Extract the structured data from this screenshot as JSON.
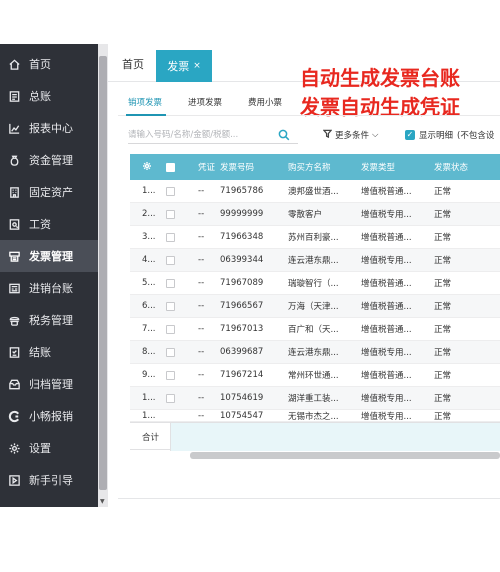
{
  "sidebar": {
    "items": [
      {
        "label": "首页",
        "icon": "home-icon"
      },
      {
        "label": "总账",
        "icon": "ledger-icon"
      },
      {
        "label": "报表中心",
        "icon": "chart-icon"
      },
      {
        "label": "资金管理",
        "icon": "money-bag-icon"
      },
      {
        "label": "固定资产",
        "icon": "building-icon"
      },
      {
        "label": "工资",
        "icon": "payroll-icon"
      },
      {
        "label": "发票管理",
        "icon": "invoice-icon",
        "active": true
      },
      {
        "label": "进销台账",
        "icon": "register-icon"
      },
      {
        "label": "税务管理",
        "icon": "tax-icon"
      },
      {
        "label": "结账",
        "icon": "checkout-icon"
      },
      {
        "label": "归档管理",
        "icon": "archive-icon"
      },
      {
        "label": "小畅报销",
        "icon": "expense-icon"
      },
      {
        "label": "设置",
        "icon": "gear-icon"
      },
      {
        "label": "新手引导",
        "icon": "guide-icon"
      }
    ]
  },
  "tabs": {
    "home": "首页",
    "active": "发票",
    "close": "×"
  },
  "banner": {
    "line1": "自动生成发票台账",
    "line2": "发票自动生成凭证"
  },
  "subtabs": {
    "sales": "销项发票",
    "input": "进项发票",
    "expense": "费用小票"
  },
  "toolbar": {
    "search_placeholder": "请输入号码/名称/金额/税额...",
    "more_filter": "更多条件",
    "show_detail": "显示明细",
    "exclude_note": "(不包含设"
  },
  "table": {
    "headers": {
      "voucher": "凭证",
      "invoice_no": "发票号码",
      "buyer": "购买方名称",
      "invoice_type": "发票类型",
      "status": "发票状态"
    },
    "rows": [
      {
        "idx": "1...",
        "voucher": "--",
        "no": "71965786",
        "buyer": "澳邦盛世酒...",
        "type": "增值税普通...",
        "status": "正常"
      },
      {
        "idx": "2...",
        "voucher": "--",
        "no": "99999999",
        "buyer": "零散客户",
        "type": "增值税专用...",
        "status": "正常"
      },
      {
        "idx": "3...",
        "voucher": "--",
        "no": "71966348",
        "buyer": "苏州百利豪...",
        "type": "增值税普通...",
        "status": "正常"
      },
      {
        "idx": "4...",
        "voucher": "--",
        "no": "06399344",
        "buyer": "连云港东鼎...",
        "type": "增值税专用...",
        "status": "正常"
      },
      {
        "idx": "5...",
        "voucher": "--",
        "no": "71967089",
        "buyer": "瑞璇智行（...",
        "type": "增值税普通...",
        "status": "正常"
      },
      {
        "idx": "6...",
        "voucher": "--",
        "no": "71966567",
        "buyer": "万海（天津...",
        "type": "增值税普通...",
        "status": "正常"
      },
      {
        "idx": "7...",
        "voucher": "--",
        "no": "71967013",
        "buyer": "百广和（天...",
        "type": "增值税普通...",
        "status": "正常"
      },
      {
        "idx": "8...",
        "voucher": "--",
        "no": "06399687",
        "buyer": "连云港东鼎...",
        "type": "增值税专用...",
        "status": "正常"
      },
      {
        "idx": "9...",
        "voucher": "--",
        "no": "71967214",
        "buyer": "常州环世通...",
        "type": "增值税普通...",
        "status": "正常"
      },
      {
        "idx": "1...",
        "voucher": "--",
        "no": "10754619",
        "buyer": "湖洋重工装...",
        "type": "增值税专用...",
        "status": "正常"
      },
      {
        "idx": "1...",
        "voucher": "--",
        "no": "10754547",
        "buyer": "无锡市杰之...",
        "type": "增值税专用...",
        "status": "正常"
      }
    ],
    "footer_total": "合计"
  },
  "colors": {
    "sidebar_bg": "#2e3138",
    "accent": "#2aa6c3",
    "table_header": "#5eb9cf",
    "banner_red": "#e8281f"
  }
}
